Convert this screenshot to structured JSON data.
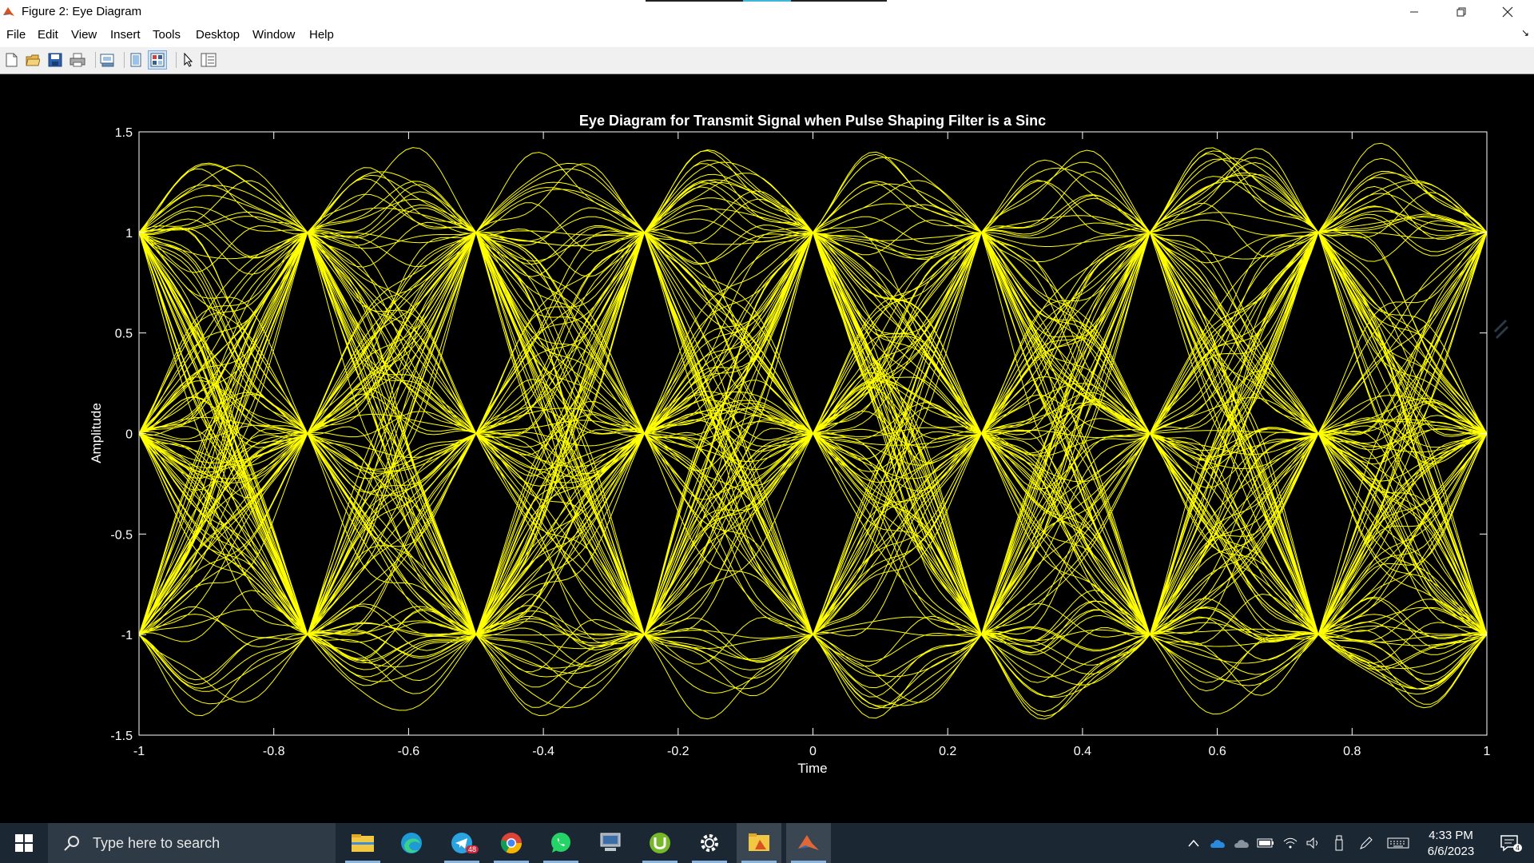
{
  "window": {
    "title": "Figure 2: Eye Diagram",
    "controls": [
      "minimize",
      "restore",
      "close"
    ]
  },
  "menu": {
    "items": [
      "File",
      "Edit",
      "View",
      "Insert",
      "Tools",
      "Desktop",
      "Window",
      "Help"
    ]
  },
  "toolbar": {
    "buttons": [
      {
        "icon": "new-figure-icon"
      },
      {
        "icon": "open-file-icon"
      },
      {
        "icon": "save-icon"
      },
      {
        "icon": "print-icon"
      },
      {
        "icon": "link-plot-icon"
      },
      {
        "icon": "hide-plot-tools-icon"
      },
      {
        "icon": "show-plot-tools-icon",
        "pressed": true
      },
      {
        "icon": "edit-plot-cursor-icon"
      },
      {
        "icon": "property-inspector-icon"
      }
    ]
  },
  "chart_data": {
    "type": "line",
    "title": "Eye Diagram for Transmit Signal when Pulse Shaping Filter is a Sinc",
    "xlabel": "Time",
    "ylabel": "Amplitude",
    "xlim": [
      -1,
      1
    ],
    "ylim": [
      -1.5,
      1.5
    ],
    "xticks": [
      -1,
      -0.8,
      -0.6,
      -0.4,
      -0.2,
      0,
      0.2,
      0.4,
      0.6,
      0.8,
      1
    ],
    "xtick_labels": [
      "-1",
      "-0.8",
      "-0.6",
      "-0.4",
      "-0.2",
      "0",
      "0.2",
      "0.4",
      "0.6",
      "0.8",
      "1"
    ],
    "yticks": [
      -1.5,
      -1,
      -0.5,
      0,
      0.5,
      1,
      1.5
    ],
    "ytick_labels": [
      "-1.5",
      "-1",
      "-0.5",
      "0",
      "0.5",
      "1",
      "1.5"
    ],
    "symbol_period": 0.25,
    "symbol_levels": [
      -1,
      0,
      1
    ],
    "trace_color": "#ffff00",
    "background": "#000000",
    "axis_color": "#ffffff",
    "grid": false
  },
  "taskbar": {
    "search_placeholder": "Type here to search",
    "apps": [
      {
        "name": "file-explorer-icon"
      },
      {
        "name": "edge-icon"
      },
      {
        "name": "telegram-icon",
        "badge": "48"
      },
      {
        "name": "chrome-icon"
      },
      {
        "name": "whatsapp-icon"
      },
      {
        "name": "network-drive-icon"
      },
      {
        "name": "utorrent-icon"
      },
      {
        "name": "settings-icon"
      },
      {
        "name": "matlab-folder-icon",
        "highlight": true
      },
      {
        "name": "matlab-icon",
        "active": true
      }
    ],
    "time": "4:33 PM",
    "date": "6/6/2023",
    "notification_count": "4"
  }
}
